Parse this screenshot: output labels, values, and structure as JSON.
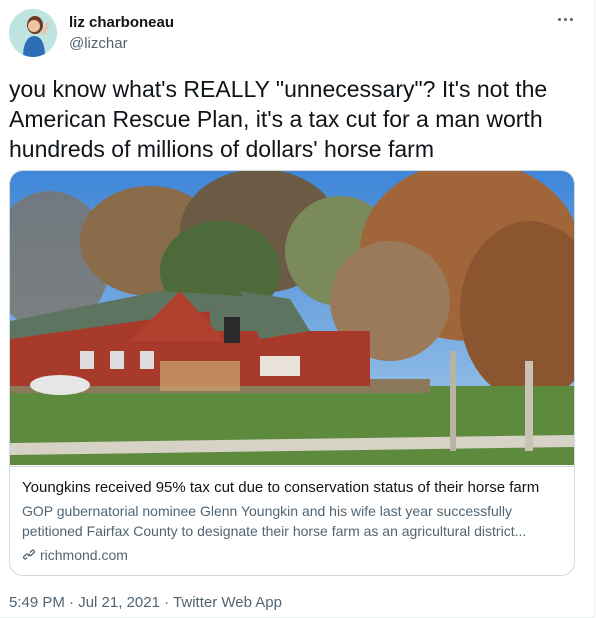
{
  "author": {
    "display_name": "liz charboneau",
    "handle": "@lizchar",
    "avatar_icon": "person-portrait-avatar"
  },
  "menu": {
    "icon": "more-horizontal-icon"
  },
  "tweet": {
    "text": "you know what's REALLY \"unnecessary\"? It's not the American Rescue Plan, it's a tax cut for a man worth hundreds of millions of dollars' horse farm"
  },
  "link_card": {
    "title": "Youngkins received 95% tax cut due to conservation status of their horse farm",
    "description": "GOP gubernatorial nominee Glenn Youngkin and his wife last year successfully petitioned Fairfax County to designate their horse farm as an agricultural district...",
    "domain": "richmond.com",
    "domain_icon": "link-icon"
  },
  "meta": {
    "time": "5:49 PM",
    "separator1": "·",
    "date": "Jul 21, 2021",
    "separator2": "·",
    "client": "Twitter Web App"
  },
  "colors": {
    "primary_text": "#0f1419",
    "secondary_text": "#536471",
    "border": "#cfd9de"
  }
}
